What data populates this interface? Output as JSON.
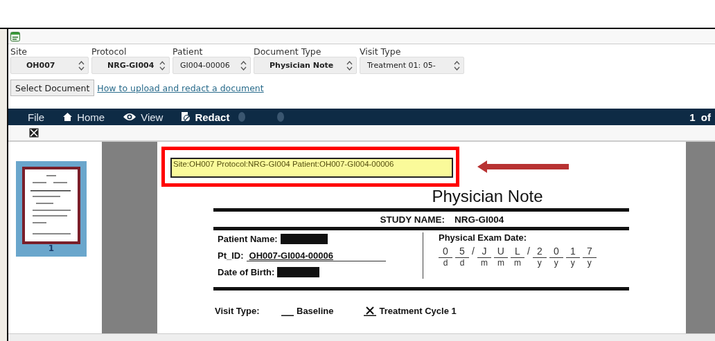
{
  "filters": [
    {
      "label": "Site",
      "value": "OH007",
      "bold": true
    },
    {
      "label": "Protocol",
      "value": "NRG-GI004",
      "bold": true
    },
    {
      "label": "Patient",
      "value": "GI004-00006",
      "bold": false
    },
    {
      "label": "Document Type",
      "value": "Physician Note",
      "bold": true
    },
    {
      "label": "Visit Type",
      "value": "Treatment 01: 05-",
      "bold": false
    }
  ],
  "select_button": "Select Document",
  "help_link": "How to upload and redact a document",
  "toolbar": {
    "items": [
      {
        "label": "File",
        "kind": "plain"
      },
      {
        "label": "Home",
        "kind": "home"
      },
      {
        "label": "View",
        "kind": "view"
      },
      {
        "label": "Redact",
        "kind": "redact"
      }
    ],
    "page_indicator": "1  of"
  },
  "thumbnails": [
    {
      "label": "1",
      "selected": true
    }
  ],
  "document": {
    "stamp": "Site:OH007 Protocol:NRG-GI004 Patient:OH007-GI004-00006",
    "title": "Physician Note",
    "study_label": "STUDY NAME:",
    "study_value": "NRG-GI004",
    "fields": [
      {
        "label": "Patient Name:",
        "kind": "redacted"
      },
      {
        "label": "Pt_ID:",
        "kind": "text",
        "value": "OH007-GI004-00006"
      },
      {
        "label": "Date of Birth:",
        "kind": "redacted"
      }
    ],
    "exam_date_label": "Physical Exam Date:",
    "exam_date": [
      {
        "kind": "char",
        "value": "0",
        "label": "d"
      },
      {
        "kind": "char",
        "value": "5",
        "label": "d"
      },
      {
        "kind": "sep",
        "value": "/"
      },
      {
        "kind": "char",
        "value": "J",
        "label": "m"
      },
      {
        "kind": "char",
        "value": "U",
        "label": "m"
      },
      {
        "kind": "char",
        "value": "L",
        "label": "m"
      },
      {
        "kind": "sep",
        "value": "/"
      },
      {
        "kind": "char",
        "value": "2",
        "label": "y"
      },
      {
        "kind": "char",
        "value": "0",
        "label": "y"
      },
      {
        "kind": "char",
        "value": "1",
        "label": "y"
      },
      {
        "kind": "char",
        "value": "7",
        "label": "y"
      }
    ],
    "visit_type_label": "Visit Type:",
    "visit_options": [
      {
        "label": "Baseline",
        "checked": false
      },
      {
        "label": "Treatment Cycle 1",
        "checked": true
      }
    ]
  }
}
